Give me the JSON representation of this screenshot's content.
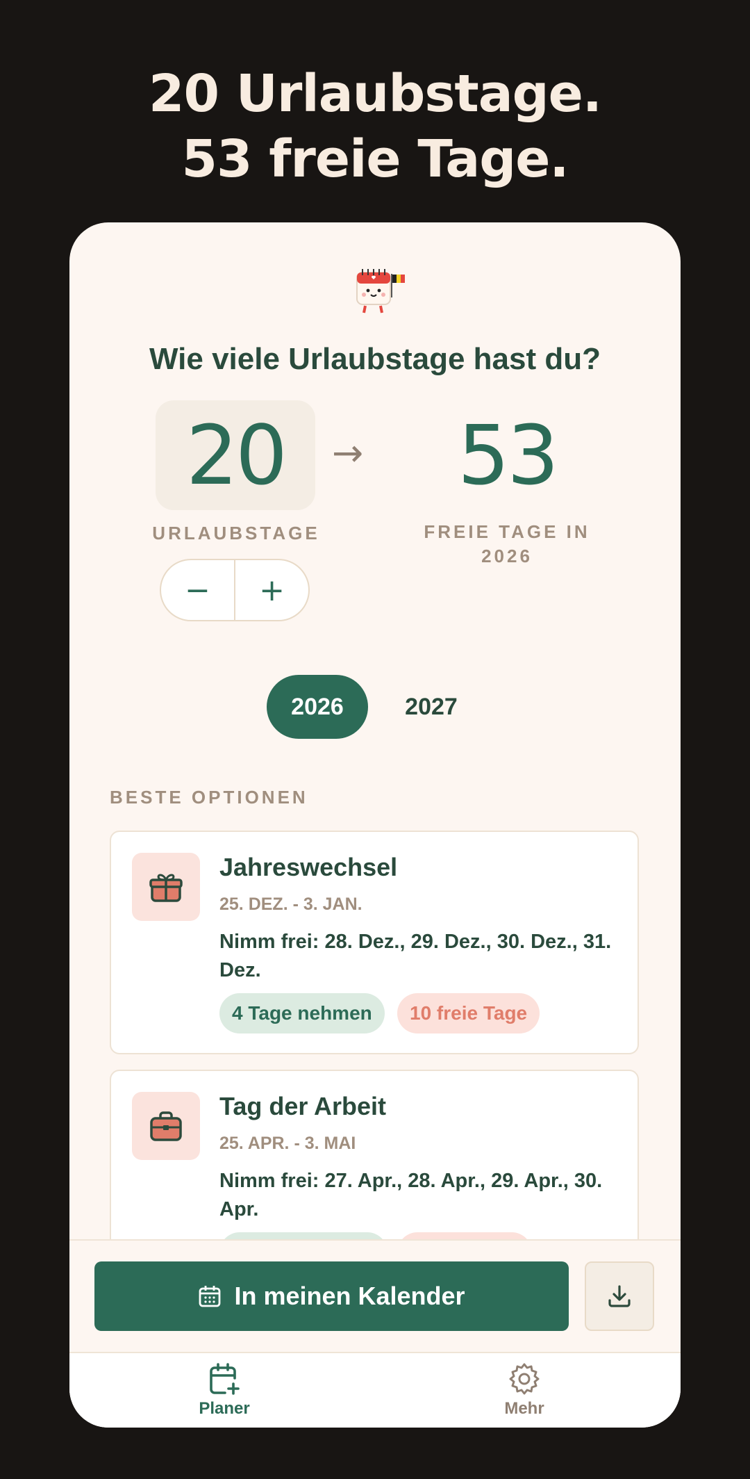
{
  "headline": {
    "line1": "20 Urlaubstage.",
    "line2": "53 freie Tage."
  },
  "planner": {
    "question": "Wie viele Urlaubstage hast du?",
    "vacation_days": "20",
    "arrow": "→",
    "free_days": "53",
    "vacation_days_label": "URLAUBSTAGE",
    "free_days_label": "FREIE TAGE IN 2026",
    "stepper": {
      "minus": "−",
      "plus": "+"
    },
    "years": [
      {
        "label": "2026",
        "selected": true
      },
      {
        "label": "2027",
        "selected": false
      }
    ]
  },
  "options": {
    "section_title": "BESTE OPTIONEN",
    "items": [
      {
        "icon": "gift-icon",
        "title": "Jahreswechsel",
        "dates": "25. DEZ. - 3. JAN.",
        "take_off": "Nimm frei: 28. Dez., 29. Dez., 30. Dez., 31. Dez.",
        "take_chip": "4 Tage nehmen",
        "free_chip": "10 freie Tage"
      },
      {
        "icon": "briefcase-icon",
        "title": "Tag der Arbeit",
        "dates": "25. APR. - 3. MAI",
        "take_off": "Nimm frei: 27. Apr., 28. Apr., 29. Apr., 30. Apr.",
        "take_chip": "",
        "free_chip": ""
      }
    ]
  },
  "actions": {
    "calendar_button": "In meinen Kalender",
    "download_icon": "download-icon"
  },
  "nav": {
    "planer": "Planer",
    "mehr": "Mehr"
  },
  "colors": {
    "primary": "#2c6b57",
    "accent": "#e07d6a",
    "background": "#181513",
    "surface": "#fdf6f1"
  }
}
